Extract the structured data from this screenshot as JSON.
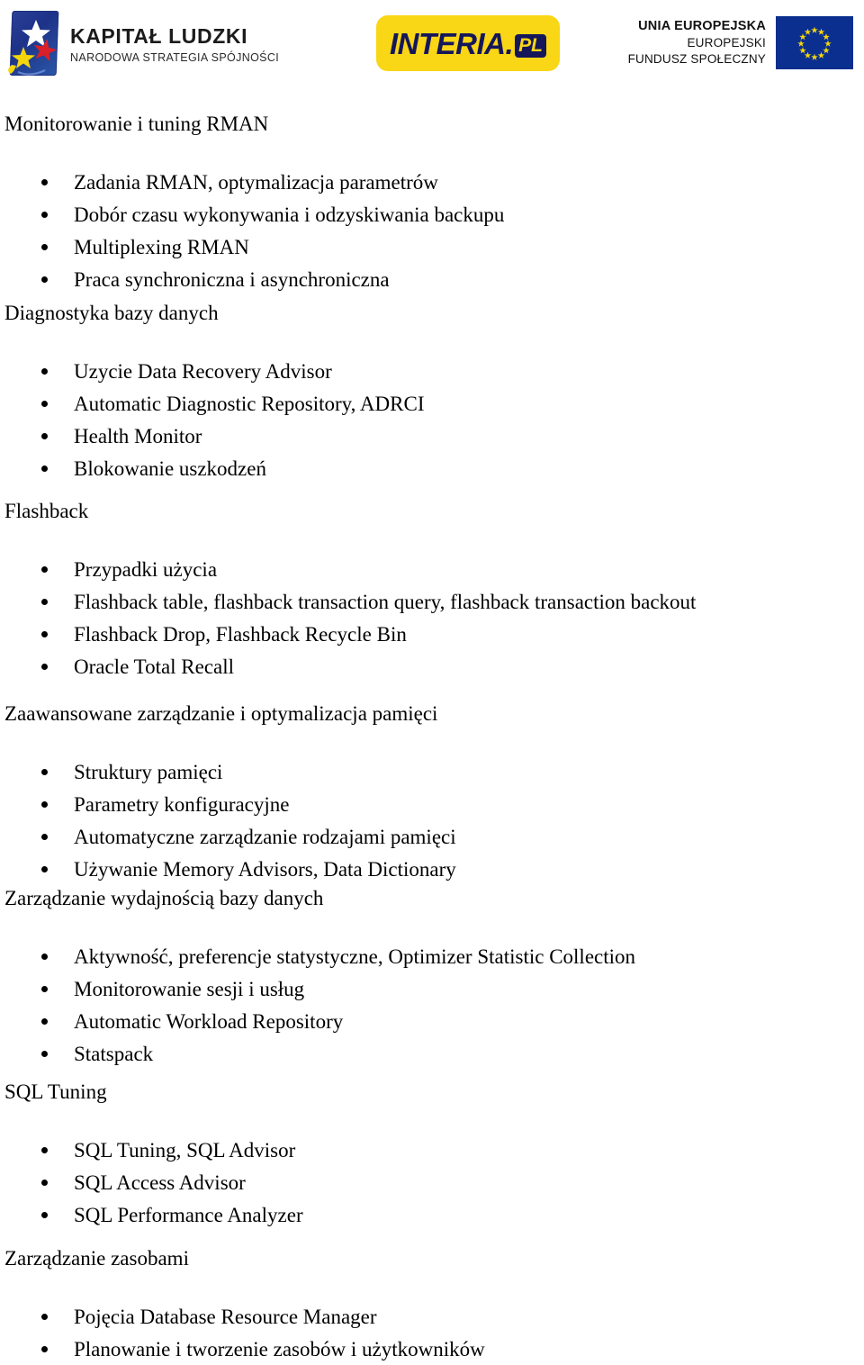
{
  "header": {
    "kapital_ludzki": {
      "emblem_name": "kapital-ludzki-emblem",
      "title": "KAPITAŁ LUDZKI",
      "subtitle": "NARODOWA STRATEGIA SPÓJNOŚCI",
      "colors": {
        "blue": "#1d3288",
        "white_star": "#ffffff",
        "yellow_star": "#f5d60c",
        "red_star": "#d9202a"
      }
    },
    "interia": {
      "word": "INTERIA.",
      "tld": "PL",
      "colors": {
        "background": "#f9d616",
        "text": "#15175a"
      }
    },
    "european_union": {
      "line_1": "UNIA EUROPEJSKA",
      "line_2": "EUROPEJSKI",
      "line_3": "FUNDUSZ SPOŁECZNY",
      "flag_name": "eu-flag",
      "colors": {
        "flag_blue": "#0a2f8f",
        "star_yellow": "#f5d60c"
      }
    }
  },
  "sections": [
    {
      "heading": "Monitorowanie i tuning RMAN",
      "bullets": [
        "Zadania RMAN, optymalizacja parametrów",
        "Dobór czasu wykonywania i odzyskiwania backupu",
        "Multiplexing RMAN",
        "Praca synchroniczna i asynchroniczna"
      ]
    },
    {
      "heading": "Diagnostyka bazy danych",
      "bullets": [
        "Uzycie Data Recovery Advisor",
        "Automatic Diagnostic Repository, ADRCI",
        "Health Monitor",
        "Blokowanie uszkodzeń"
      ]
    },
    {
      "heading": "Flashback",
      "bullets": [
        "Przypadki użycia",
        "Flashback table, flashback transaction query, flashback transaction backout",
        "Flashback Drop, Flashback Recycle Bin",
        "Oracle Total Recall"
      ]
    },
    {
      "heading": "Zaawansowane zarządzanie i optymalizacja pamięci",
      "bullets": [
        "Struktury pamięci",
        "Parametry konfiguracyjne",
        "Automatyczne zarządzanie rodzajami pamięci",
        "Używanie Memory Advisors, Data Dictionary"
      ]
    },
    {
      "heading": "Zarządzanie wydajnością bazy danych",
      "bullets": [
        "Aktywność, preferencje statystyczne, Optimizer Statistic Collection",
        "Monitorowanie sesji i usług",
        "Automatic Workload Repository",
        "Statspack"
      ]
    },
    {
      "heading": "SQL Tuning",
      "bullets": [
        "SQL Tuning, SQL Advisor",
        "SQL Access Advisor",
        "SQL Performance Analyzer"
      ]
    },
    {
      "heading": "Zarządzanie zasobami",
      "bullets": [
        "Pojęcia Database Resource Manager",
        "Planowanie i tworzenie zasobów i użytkowników"
      ]
    }
  ]
}
